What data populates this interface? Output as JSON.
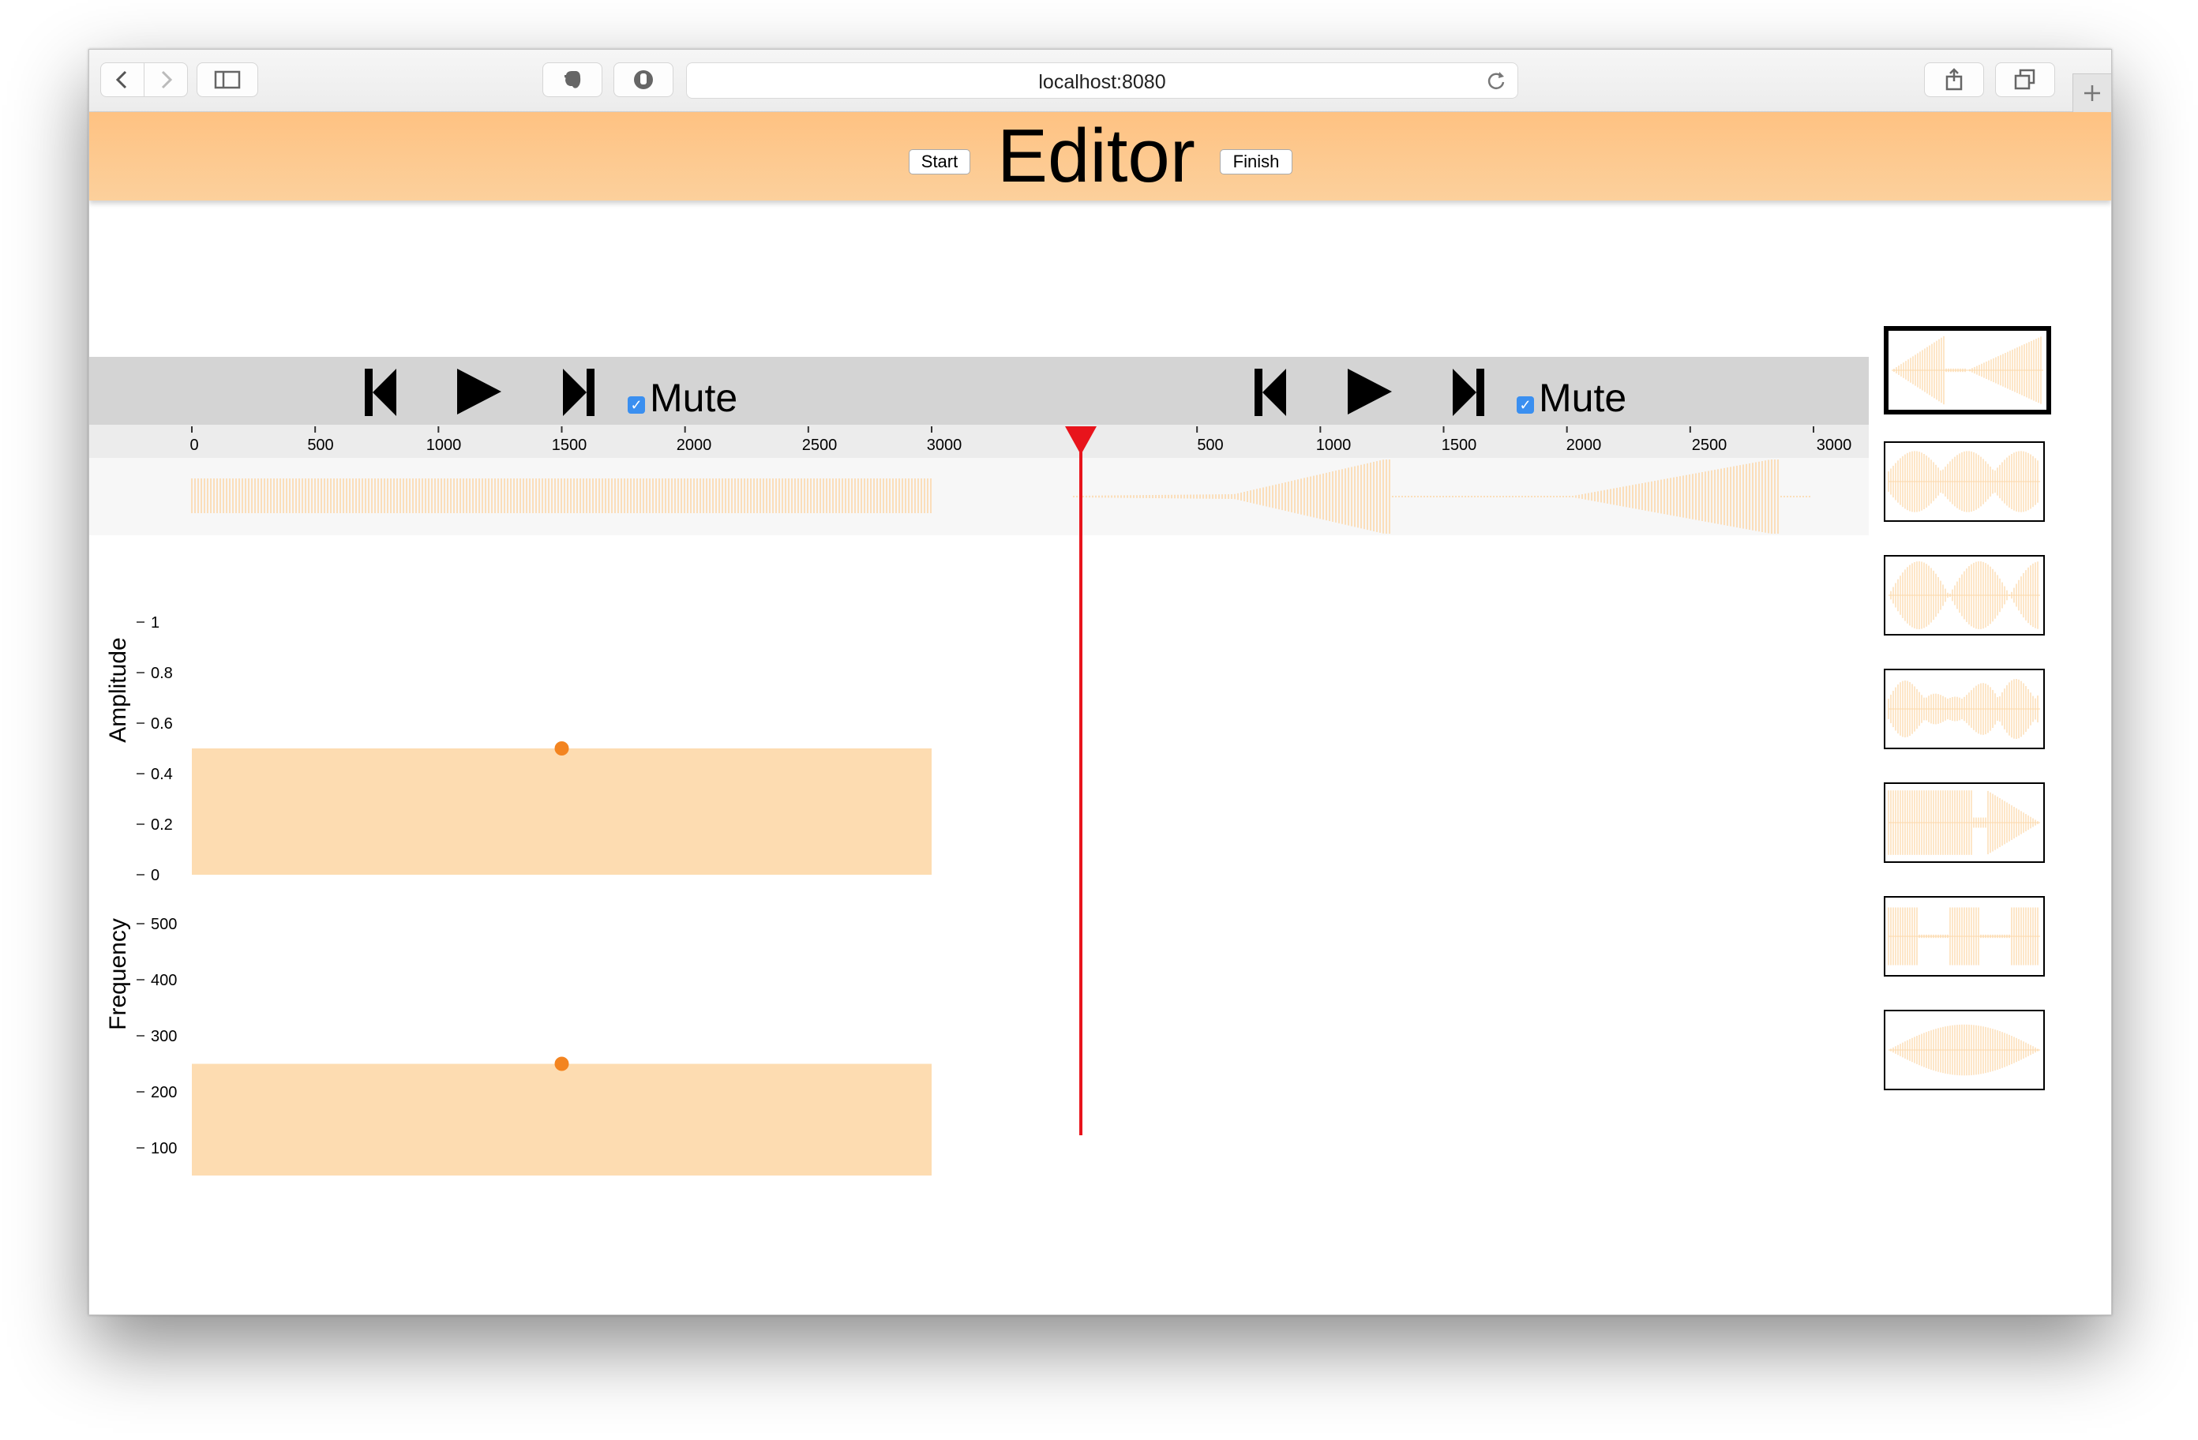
{
  "browser": {
    "url": "localhost:8080"
  },
  "app": {
    "title": "Editor",
    "start_label": "Start",
    "finish_label": "Finish"
  },
  "tracks": [
    {
      "mute_label": "Mute",
      "muted": true
    },
    {
      "mute_label": "Mute",
      "muted": true
    }
  ],
  "timeline": {
    "ticks_left": [
      "0",
      "500",
      "1000",
      "1500",
      "2000",
      "2500",
      "3000"
    ],
    "ticks_right": [
      "500",
      "1000",
      "1500",
      "2000",
      "2500",
      "3000"
    ],
    "playhead_color": "#e8141c"
  },
  "amplitude_axis": {
    "label": "Amplitude",
    "ticks": [
      "1",
      "0.8",
      "0.6",
      "0.4",
      "0.2",
      "0"
    ]
  },
  "frequency_axis": {
    "label": "Frequency",
    "ticks": [
      "500",
      "400",
      "300",
      "200",
      "100"
    ]
  },
  "segments": [
    {
      "start": 0,
      "end": 3000,
      "amplitude": 0.5,
      "frequency": 250
    }
  ],
  "colors": {
    "header": "#fec282",
    "wave": "#fcd8aa",
    "bar": "#fddcb1",
    "control_point": "#f38420",
    "playhead": "#e8141c"
  },
  "library": [
    {
      "name": "preset-1",
      "selected": true
    },
    {
      "name": "preset-2",
      "selected": false
    },
    {
      "name": "preset-3",
      "selected": false
    },
    {
      "name": "preset-4",
      "selected": false
    },
    {
      "name": "preset-5",
      "selected": false
    },
    {
      "name": "preset-6",
      "selected": false
    },
    {
      "name": "preset-7",
      "selected": false
    }
  ]
}
